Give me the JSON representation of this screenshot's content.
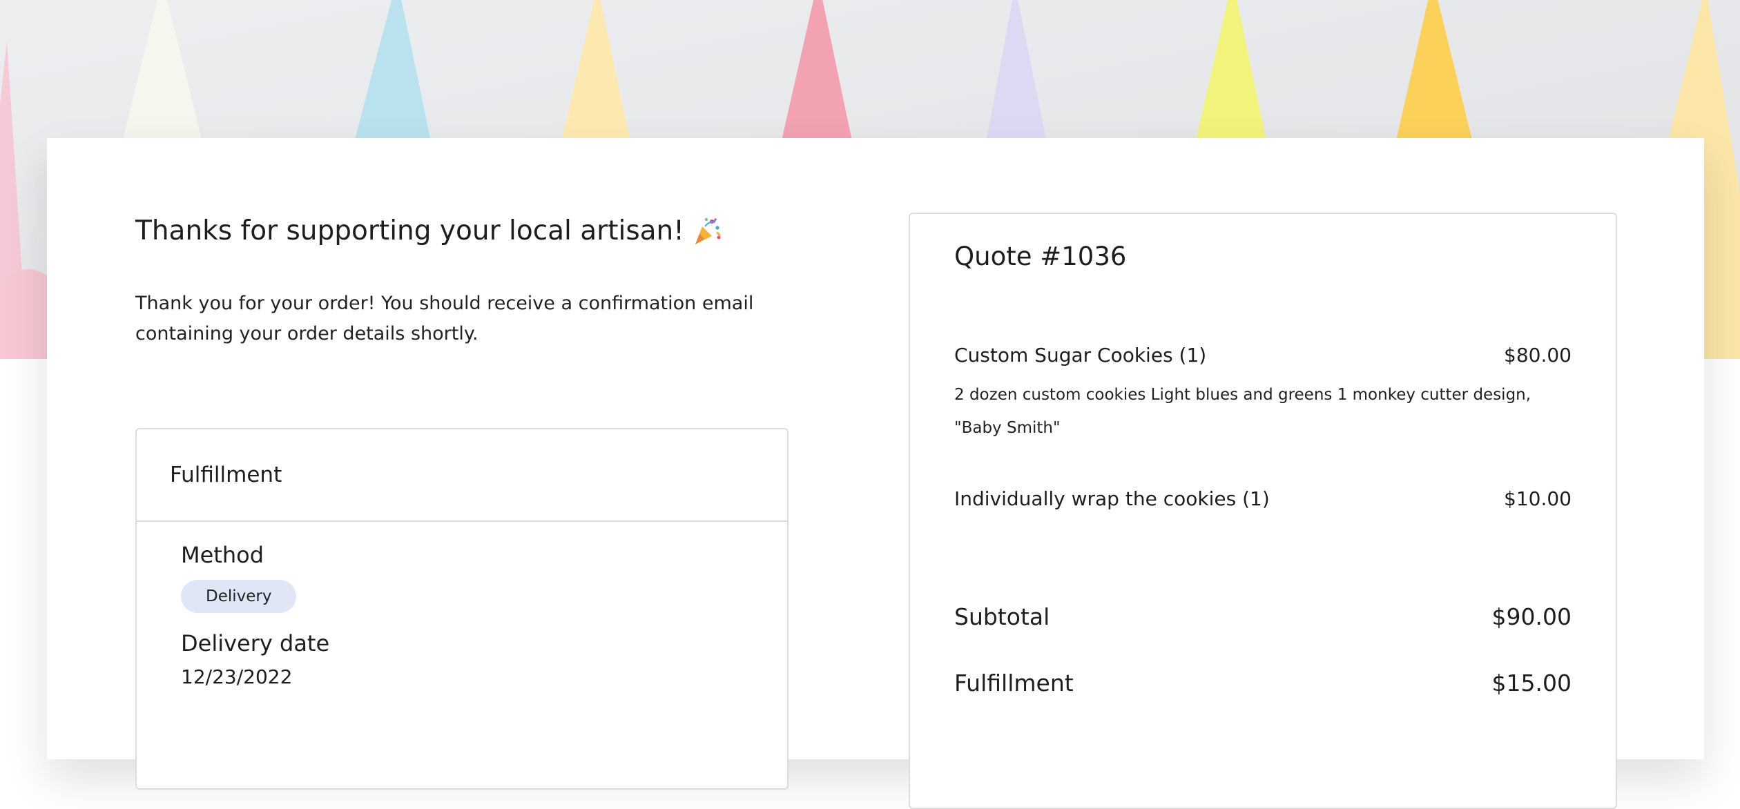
{
  "hero": {
    "image": "pastel-piping-bags-banner"
  },
  "thanks": {
    "title": "Thanks for supporting your local artisan!",
    "icon": "party-popper-icon",
    "message": "Thank you for your order! You should receive a confirmation email containing your order details shortly."
  },
  "fulfillment": {
    "heading": "Fulfillment",
    "method_label": "Method",
    "method_value": "Delivery",
    "date_label": "Delivery date",
    "date_value": "12/23/2022"
  },
  "quote": {
    "title": "Quote #1036",
    "items": [
      {
        "name": "Custom Sugar Cookies (1)",
        "price": "$80.00",
        "description": "2 dozen custom cookies Light blues and greens 1 monkey cutter design, \"Baby Smith\""
      },
      {
        "name": "Individually wrap the cookies (1)",
        "price": "$10.00"
      }
    ],
    "subtotal_label": "Subtotal",
    "subtotal_value": "$90.00",
    "fulfillment_label": "Fulfillment",
    "fulfillment_value": "$15.00"
  },
  "colors": {
    "chip_bg": "#dfe7f7",
    "border": "#dcdcdc"
  }
}
